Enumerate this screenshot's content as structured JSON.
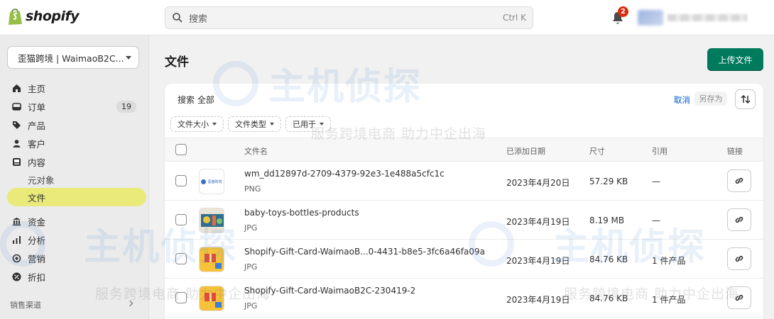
{
  "app": {
    "logo_text": "shopify",
    "search_placeholder": "搜索",
    "search_shortcut": "Ctrl K",
    "notification_count": "2"
  },
  "sidebar": {
    "store_name": "歪猫跨境 | WaimaoB2C...",
    "items": [
      {
        "label": "主页",
        "icon": "home-icon"
      },
      {
        "label": "订单",
        "icon": "orders-icon",
        "count": "19"
      },
      {
        "label": "产品",
        "icon": "tag-icon"
      },
      {
        "label": "客户",
        "icon": "person-icon"
      },
      {
        "label": "内容",
        "icon": "content-icon"
      }
    ],
    "sub_items": [
      {
        "label": "元对象"
      },
      {
        "label": "文件",
        "active": true
      }
    ],
    "items2": [
      {
        "label": "资金",
        "icon": "bank-icon"
      },
      {
        "label": "分析",
        "icon": "chart-icon"
      },
      {
        "label": "营销",
        "icon": "target-icon"
      },
      {
        "label": "折扣",
        "icon": "discount-icon"
      }
    ],
    "section_label": "销售渠道"
  },
  "main": {
    "title": "文件",
    "upload_label": "上传文件",
    "search_text": "搜索 全部",
    "cancel_label": "取消",
    "save_as_label": "另存为",
    "filters": [
      "文件大小",
      "文件类型",
      "已用于"
    ],
    "columns": {
      "name": "文件名",
      "date": "已添加日期",
      "size": "尺寸",
      "refs": "引用",
      "link": "链接"
    },
    "rows": [
      {
        "name": "wm_dd12897d-2709-4379-92e3-1e488a5cfc1c",
        "type": "PNG",
        "date": "2023年4月20日",
        "size": "57.29 KB",
        "refs": "—",
        "thumb": "logo"
      },
      {
        "name": "baby-toys-bottles-products",
        "type": "JPG",
        "date": "2023年4月19日",
        "size": "8.19 MB",
        "refs": "—",
        "thumb": "toys"
      },
      {
        "name": "Shopify-Gift-Card-WaimaoB...0-4431-b8e5-3fc6a46fa09a",
        "type": "JPG",
        "date": "2023年4月19日",
        "size": "84.76 KB",
        "refs": "1 件产品",
        "thumb": "gift"
      },
      {
        "name": "Shopify-Gift-Card-WaimaoB2C-230419-2",
        "type": "JPG",
        "date": "2023年4月19日",
        "size": "84.76 KB",
        "refs": "1 件产品",
        "thumb": "gift"
      }
    ],
    "thumb_logo_text": "歪猫跨境"
  },
  "watermark": {
    "brand": "主机侦探",
    "slogan": "服务跨境电商 助力中企出海"
  },
  "colors": {
    "primary_button": "#007a5c",
    "active_nav_highlight": "#eaea7a",
    "link_blue": "#005bd3",
    "badge_red": "#d72c0d"
  }
}
